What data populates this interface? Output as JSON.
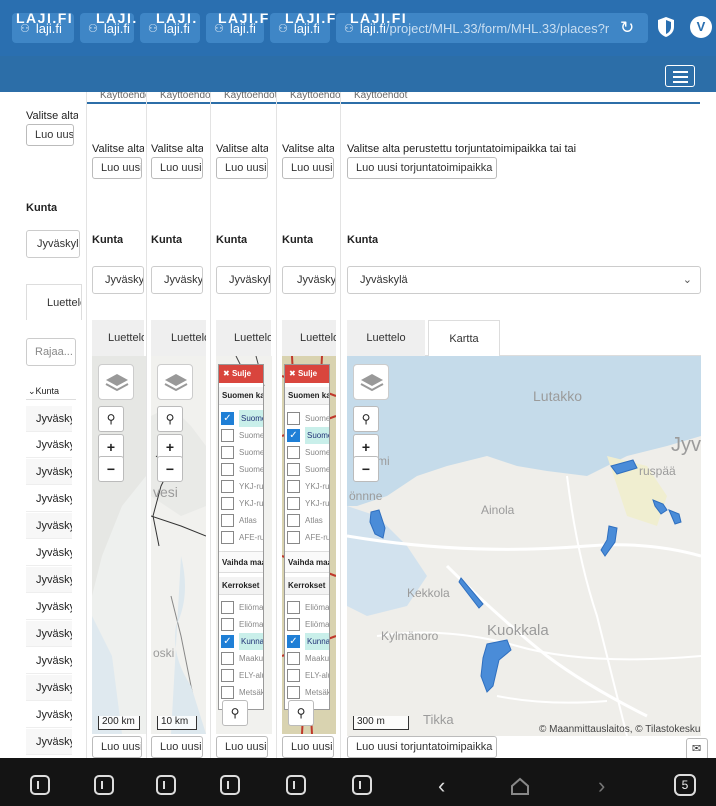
{
  "browser": {
    "tab_title": "laji.fi",
    "url_host": "laji.fi",
    "url_path": "/project/MHL.33/form/MHL.33/places?r",
    "tab_count": "5"
  },
  "site": {
    "brand": "LAJI.FI"
  },
  "form": {
    "top_tab_label": "Käyttöehdot",
    "instruction": "Valitse alta perustettu torjuntatoimipaikka tai tai",
    "create_button": "Luo uusi torjuntatoimipaikka",
    "municipality_label": "Kunta",
    "municipality_value": "Jyväskylä",
    "filter_placeholder": "Rajaa...",
    "column_header": "Kunta",
    "view_tabs": [
      {
        "label": "Luettelo"
      },
      {
        "label": "Kartta"
      }
    ],
    "list_rows": [
      "Jyväskylä",
      "Jyväskylä",
      "Jyväskylä",
      "Jyväskylä",
      "Jyväskylä",
      "Jyväskylä",
      "Jyväskylä",
      "Jyväskylä",
      "Jyväskylä",
      "Jyväskylä",
      "Jyväskylä",
      "Jyväskylä",
      "Jyväskylä"
    ]
  },
  "map": {
    "scales": [
      "200 km",
      "10 km",
      "300 m"
    ],
    "attribution": "© Maanmittauslaitos, © Tilastokeskus",
    "place_names": [
      "Lutakko",
      "Jyv",
      "Ainola",
      "Kekkola",
      "Kuokkala",
      "Kylmänoro",
      "niemi",
      "önnne",
      "Tikka",
      "ruspää",
      "vesi",
      "oski"
    ],
    "polygon_color": "#4a8cd8"
  },
  "layers": {
    "close_label": "Sulje",
    "basemap_header": "Suomen kartat",
    "basemap_items": [
      {
        "label": "Suomen kartta",
        "checked": true
      },
      {
        "label": "Suomen ortokuva",
        "checked": false
      },
      {
        "label": "Suomen maastokartta",
        "checked": false
      },
      {
        "label": "Suomen taustakartta",
        "checked": false
      },
      {
        "label": "YKJ-ruudukko",
        "checked": false
      },
      {
        "label": "YKJ-ruudut",
        "checked": false
      },
      {
        "label": "Atlas",
        "checked": false
      },
      {
        "label": "AFE-ruudukko",
        "checked": false
      }
    ],
    "basemap_items_b": [
      {
        "label": "Suomen kartta",
        "checked": false
      },
      {
        "label": "Suomen ortokuva",
        "checked": true
      },
      {
        "label": "Suomen maastokartta",
        "checked": false
      },
      {
        "label": "Suomen taustakartta",
        "checked": false
      },
      {
        "label": "YKJ-ruudukko",
        "checked": false
      },
      {
        "label": "YKJ-ruudut",
        "checked": false
      },
      {
        "label": "Atlas",
        "checked": false
      },
      {
        "label": "AFE-ruudukko",
        "checked": false
      }
    ],
    "switch_label": "Vaihda maailmankarttaan",
    "overlay_header": "Kerrokset",
    "overlay_items": [
      {
        "label": "Eliömaakunnat",
        "checked": false
      },
      {
        "label": "Eliömaakunnat nimet",
        "checked": false
      },
      {
        "label": "Kunnat",
        "checked": true
      },
      {
        "label": "Maakunnat",
        "checked": false
      },
      {
        "label": "ELY-alueet",
        "checked": false
      },
      {
        "label": "Metsäkeskukset",
        "checked": false
      }
    ]
  },
  "colors": {
    "browser_bar": "#2a6fb0",
    "site_bar": "#2c6ea8",
    "close_red": "#d9453d",
    "check_blue": "#1f7fd6"
  }
}
